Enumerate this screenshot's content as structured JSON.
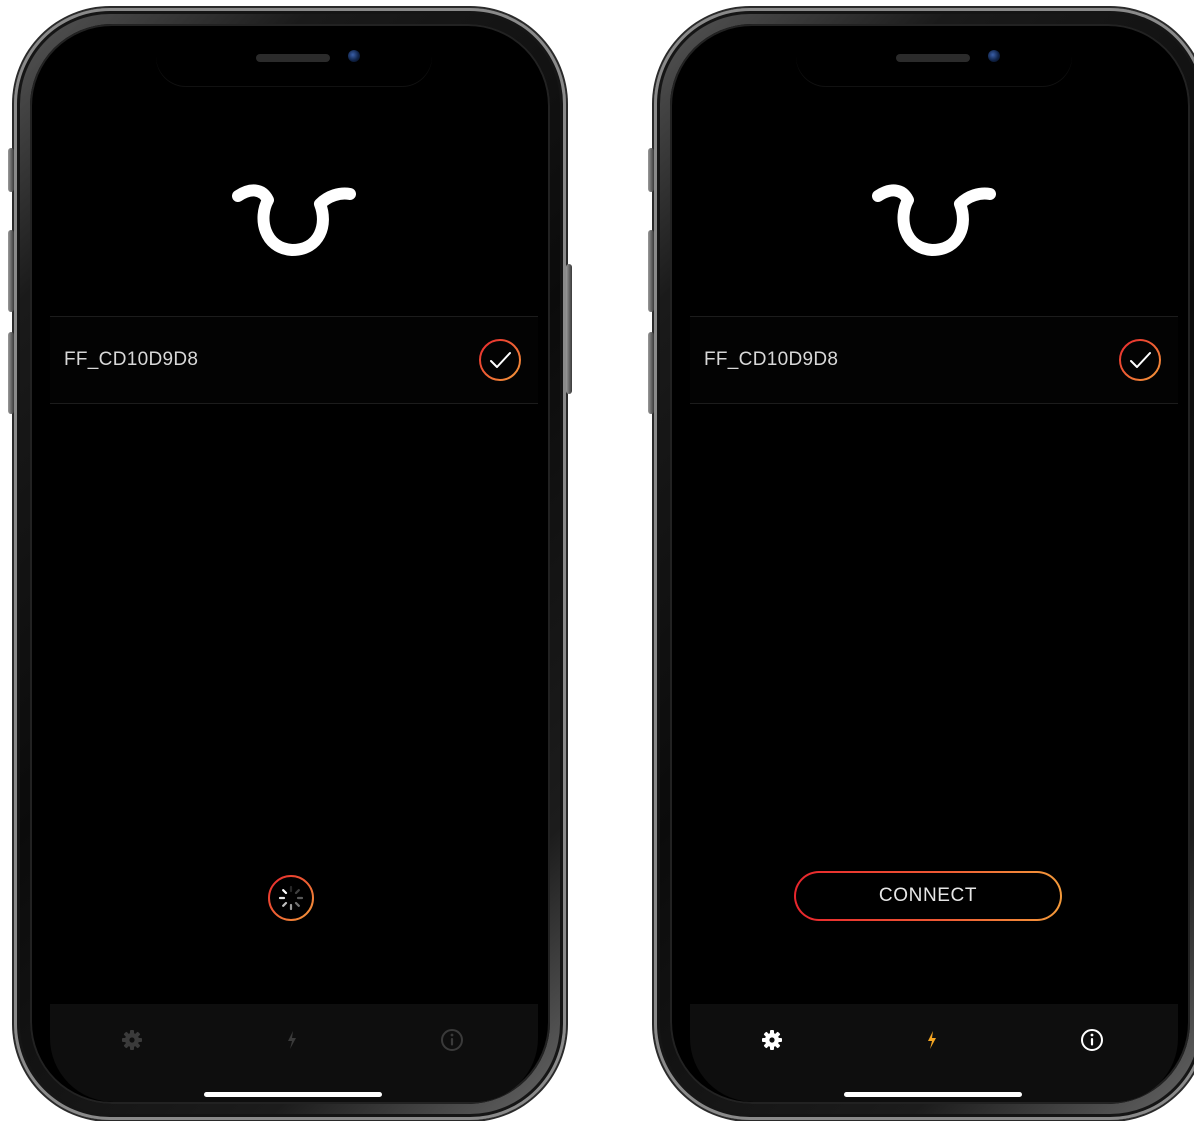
{
  "screens": [
    {
      "device_name": "FF_CD10D9D8",
      "state": "scanning",
      "tabbar_active": false
    },
    {
      "device_name": "FF_CD10D9D8",
      "state": "ready",
      "connect_label": "CONNECT",
      "tabbar_active": true
    }
  ],
  "icons": {
    "logo": "horns-logo-icon",
    "selected": "checkmark-circle-icon",
    "loading": "spinner-icon",
    "tab_settings": "gear-icon",
    "tab_power": "lightning-icon",
    "tab_info": "info-icon"
  },
  "colors": {
    "background": "#000000",
    "accent_red": "#e8262d",
    "accent_orange": "#f49a3a",
    "tabbar": "#0e0e0e",
    "text": "#d8d8d8"
  }
}
